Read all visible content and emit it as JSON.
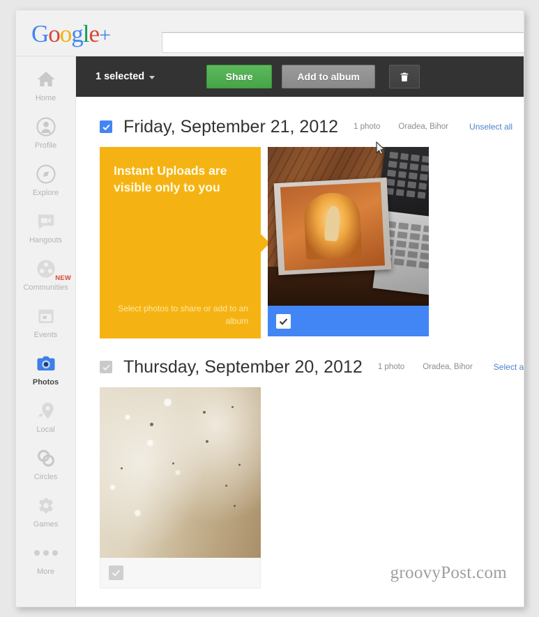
{
  "header": {
    "logo_parts": [
      {
        "ch": "G",
        "cls": "l-b"
      },
      {
        "ch": "o",
        "cls": "l-r"
      },
      {
        "ch": "o",
        "cls": "l-y"
      },
      {
        "ch": "g",
        "cls": "l-b"
      },
      {
        "ch": "l",
        "cls": "l-g"
      },
      {
        "ch": "e",
        "cls": "l-r"
      }
    ],
    "logo_text": "Google",
    "logo_plus": "+",
    "search_value": "",
    "search_placeholder": ""
  },
  "sidebar": {
    "items": [
      {
        "label": "Home",
        "icon": "home-icon",
        "active": false,
        "badge": ""
      },
      {
        "label": "Profile",
        "icon": "profile-icon",
        "active": false,
        "badge": ""
      },
      {
        "label": "Explore",
        "icon": "explore-icon",
        "active": false,
        "badge": ""
      },
      {
        "label": "Hangouts",
        "icon": "hangouts-icon",
        "active": false,
        "badge": ""
      },
      {
        "label": "Communities",
        "icon": "communities-icon",
        "active": false,
        "badge": "NEW"
      },
      {
        "label": "Events",
        "icon": "events-icon",
        "active": false,
        "badge": ""
      },
      {
        "label": "Photos",
        "icon": "photos-camera-icon",
        "active": true,
        "badge": ""
      },
      {
        "label": "Local",
        "icon": "local-pin-icon",
        "active": false,
        "badge": ""
      },
      {
        "label": "Circles",
        "icon": "circles-icon",
        "active": false,
        "badge": ""
      },
      {
        "label": "Games",
        "icon": "games-icon",
        "active": false,
        "badge": ""
      },
      {
        "label": "More",
        "icon": "more-dots-icon",
        "active": false,
        "badge": ""
      }
    ]
  },
  "toolbar": {
    "selected_label": "1 selected",
    "share_label": "Share",
    "add_to_album_label": "Add to album",
    "delete_icon": "trash-icon"
  },
  "groups": [
    {
      "checked": true,
      "date": "Friday, September 21, 2012",
      "count": "1 photo",
      "location": "Oradea, Bihor",
      "select_link": "Unselect all",
      "info_card": {
        "heading": "Instant Uploads are visible only to you",
        "footer": "Select photos to share or add to an album"
      },
      "photo": {
        "name": "cd-jewel-case-photo",
        "selected": true
      }
    },
    {
      "checked": false,
      "date": "Thursday, September 20, 2012",
      "count": "1 photo",
      "location": "Oradea, Bihor",
      "select_link": "Select all",
      "photo": {
        "name": "foam-closeup-photo",
        "selected": false
      }
    }
  ],
  "watermark": "groovyPost.com",
  "colors": {
    "accent_blue": "#4285f4",
    "share_green": "#4caf50",
    "info_yellow": "#f5b313",
    "toolbar_dark": "#333333",
    "link_blue": "#4b82c8",
    "badge_red": "#d64937"
  }
}
